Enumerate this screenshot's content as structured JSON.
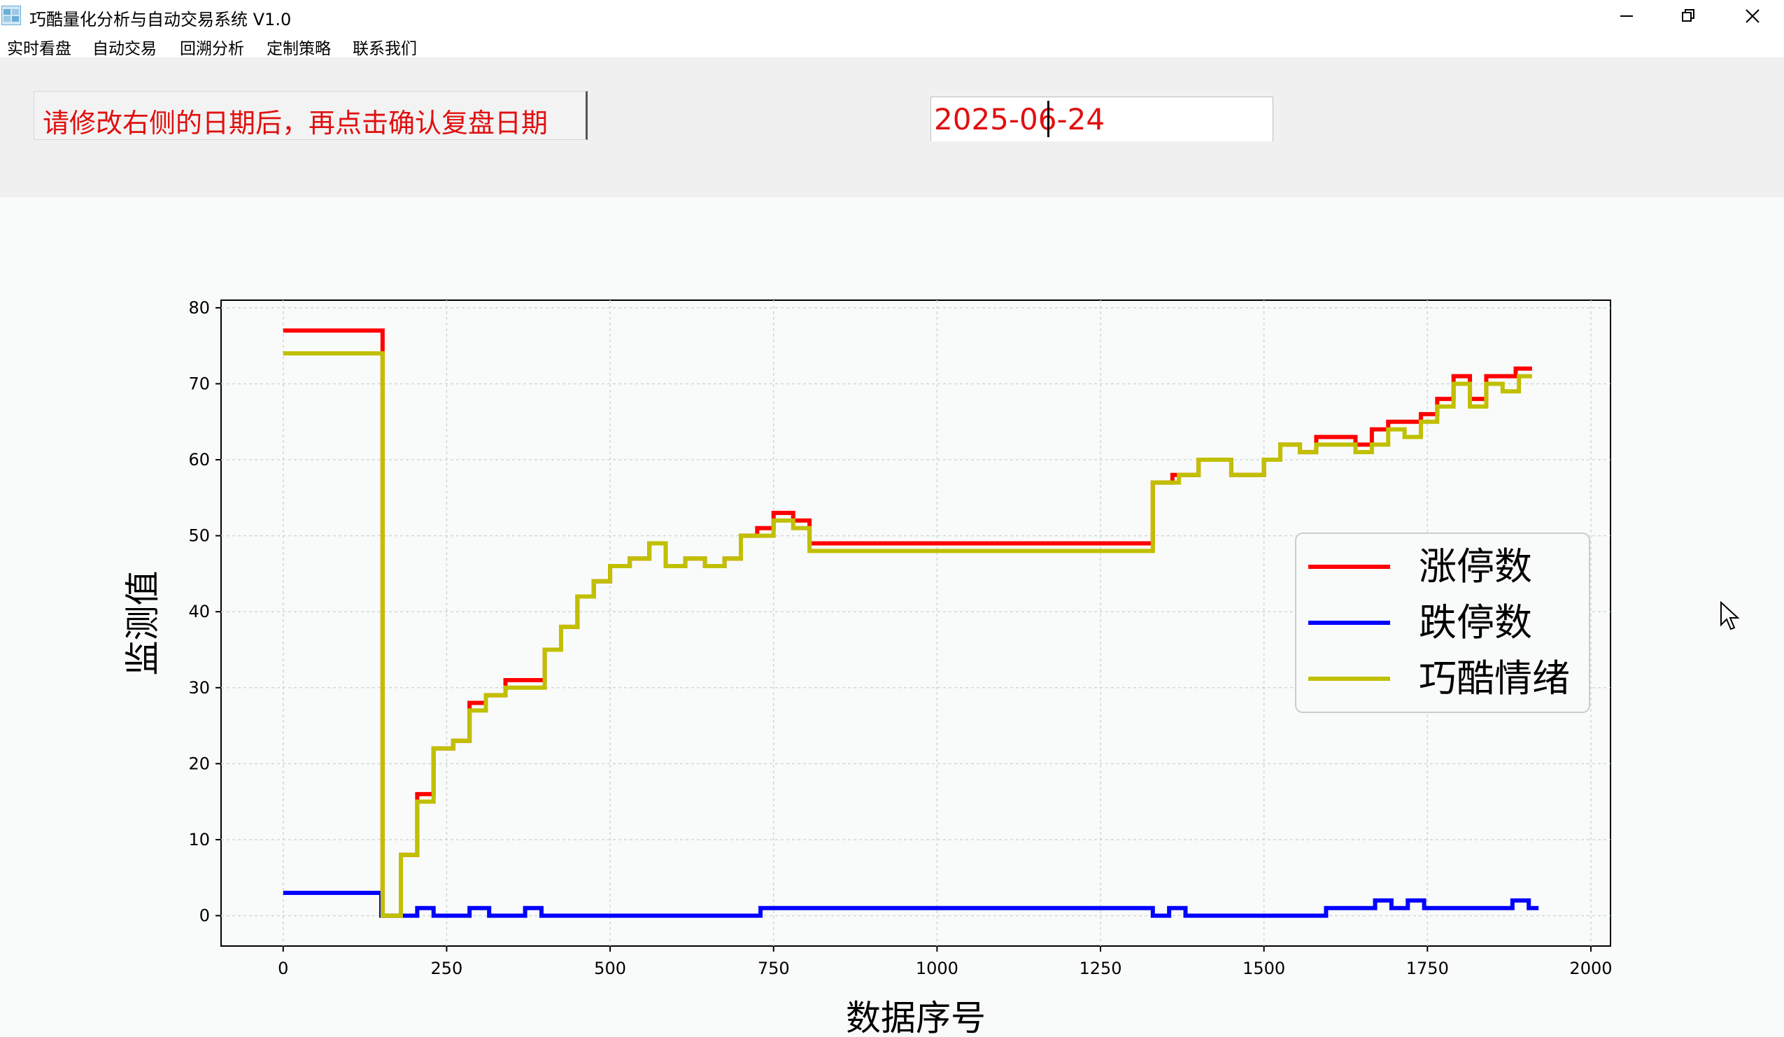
{
  "window": {
    "title": "巧酷量化分析与自动交易系统 V1.0",
    "icon": "app-logo-icon",
    "controls": [
      "minimize-icon",
      "restore-icon",
      "close-icon"
    ]
  },
  "menu": {
    "items": [
      "实时看盘",
      "自动交易",
      "回溯分析",
      "定制策略",
      "联系我们"
    ]
  },
  "replay": {
    "prompt": "请修改右侧的日期后，再点击确认复盘日期",
    "date_value": "2025-06-24",
    "text_color": "#e01010"
  },
  "chart_data": {
    "type": "line",
    "xlabel": "数据序号",
    "ylabel": "监测值",
    "xlim": [
      -95,
      2030
    ],
    "ylim": [
      -4,
      81
    ],
    "xticks": [
      0,
      250,
      500,
      750,
      1000,
      1250,
      1500,
      1750,
      2000
    ],
    "yticks": [
      0,
      10,
      20,
      30,
      40,
      50,
      60,
      70,
      80
    ],
    "grid": true,
    "legend_position": "center-right",
    "series": [
      {
        "name": "涨停数",
        "color": "#ff0000",
        "steps": [
          [
            0,
            77
          ],
          [
            150,
            77
          ],
          [
            152,
            0
          ],
          [
            180,
            8
          ],
          [
            205,
            16
          ],
          [
            230,
            22
          ],
          [
            260,
            23
          ],
          [
            285,
            28
          ],
          [
            310,
            29
          ],
          [
            340,
            31
          ],
          [
            390,
            31
          ],
          [
            400,
            35
          ],
          [
            425,
            38
          ],
          [
            450,
            42
          ],
          [
            475,
            44
          ],
          [
            500,
            46
          ],
          [
            530,
            47
          ],
          [
            560,
            49
          ],
          [
            585,
            46
          ],
          [
            615,
            47
          ],
          [
            645,
            46
          ],
          [
            675,
            47
          ],
          [
            700,
            50
          ],
          [
            725,
            51
          ],
          [
            750,
            53
          ],
          [
            780,
            52
          ],
          [
            805,
            49
          ],
          [
            1325,
            49
          ],
          [
            1330,
            57
          ],
          [
            1360,
            58
          ],
          [
            1400,
            60
          ],
          [
            1450,
            58
          ],
          [
            1500,
            60
          ],
          [
            1525,
            62
          ],
          [
            1555,
            61
          ],
          [
            1580,
            63
          ],
          [
            1640,
            62
          ],
          [
            1665,
            64
          ],
          [
            1690,
            65
          ],
          [
            1740,
            66
          ],
          [
            1765,
            68
          ],
          [
            1790,
            71
          ],
          [
            1815,
            68
          ],
          [
            1840,
            71
          ],
          [
            1885,
            72
          ],
          [
            1910,
            72
          ]
        ]
      },
      {
        "name": "跌停数",
        "color": "#0000ff",
        "steps": [
          [
            0,
            3
          ],
          [
            145,
            3
          ],
          [
            150,
            0
          ],
          [
            205,
            1
          ],
          [
            230,
            0
          ],
          [
            285,
            1
          ],
          [
            315,
            0
          ],
          [
            370,
            1
          ],
          [
            395,
            0
          ],
          [
            730,
            1
          ],
          [
            1325,
            1
          ],
          [
            1330,
            0
          ],
          [
            1355,
            1
          ],
          [
            1380,
            0
          ],
          [
            1590,
            0
          ],
          [
            1595,
            1
          ],
          [
            1670,
            2
          ],
          [
            1695,
            1
          ],
          [
            1720,
            2
          ],
          [
            1745,
            1
          ],
          [
            1880,
            2
          ],
          [
            1905,
            1
          ],
          [
            1920,
            1
          ]
        ]
      },
      {
        "name": "巧酷情绪",
        "color": "#c0c000",
        "steps": [
          [
            0,
            74
          ],
          [
            150,
            74
          ],
          [
            152,
            0
          ],
          [
            180,
            8
          ],
          [
            205,
            15
          ],
          [
            230,
            22
          ],
          [
            260,
            23
          ],
          [
            285,
            27
          ],
          [
            310,
            29
          ],
          [
            340,
            30
          ],
          [
            390,
            30
          ],
          [
            400,
            35
          ],
          [
            425,
            38
          ],
          [
            450,
            42
          ],
          [
            475,
            44
          ],
          [
            500,
            46
          ],
          [
            530,
            47
          ],
          [
            560,
            49
          ],
          [
            585,
            46
          ],
          [
            615,
            47
          ],
          [
            645,
            46
          ],
          [
            675,
            47
          ],
          [
            700,
            50
          ],
          [
            725,
            50
          ],
          [
            750,
            52
          ],
          [
            780,
            51
          ],
          [
            805,
            48
          ],
          [
            1325,
            48
          ],
          [
            1330,
            57
          ],
          [
            1370,
            58
          ],
          [
            1400,
            60
          ],
          [
            1450,
            58
          ],
          [
            1500,
            60
          ],
          [
            1525,
            62
          ],
          [
            1555,
            61
          ],
          [
            1580,
            62
          ],
          [
            1640,
            61
          ],
          [
            1665,
            62
          ],
          [
            1690,
            64
          ],
          [
            1715,
            63
          ],
          [
            1740,
            65
          ],
          [
            1765,
            67
          ],
          [
            1790,
            70
          ],
          [
            1815,
            67
          ],
          [
            1840,
            70
          ],
          [
            1865,
            69
          ],
          [
            1890,
            71
          ],
          [
            1910,
            71
          ]
        ]
      }
    ]
  }
}
